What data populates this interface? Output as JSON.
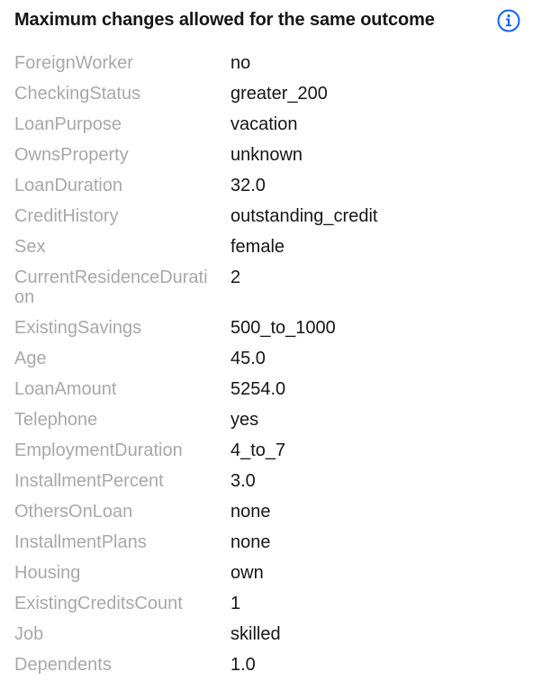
{
  "header": {
    "title": "Maximum changes allowed for the same outcome",
    "info_icon": "info-icon",
    "accent_color": "#0f62fe"
  },
  "features": [
    {
      "label": "ForeignWorker",
      "value": "no"
    },
    {
      "label": "CheckingStatus",
      "value": "greater_200"
    },
    {
      "label": "LoanPurpose",
      "value": "vacation"
    },
    {
      "label": "OwnsProperty",
      "value": "unknown"
    },
    {
      "label": "LoanDuration",
      "value": "32.0"
    },
    {
      "label": "CreditHistory",
      "value": "outstanding_credit"
    },
    {
      "label": "Sex",
      "value": "female"
    },
    {
      "label": "CurrentResidenceDuration",
      "value": "2"
    },
    {
      "label": "ExistingSavings",
      "value": "500_to_1000"
    },
    {
      "label": "Age",
      "value": "45.0"
    },
    {
      "label": "LoanAmount",
      "value": "5254.0"
    },
    {
      "label": "Telephone",
      "value": "yes"
    },
    {
      "label": "EmploymentDuration",
      "value": "4_to_7"
    },
    {
      "label": "InstallmentPercent",
      "value": "3.0"
    },
    {
      "label": "OthersOnLoan",
      "value": "none"
    },
    {
      "label": "InstallmentPlans",
      "value": "none"
    },
    {
      "label": "Housing",
      "value": "own"
    },
    {
      "label": "ExistingCreditsCount",
      "value": "1"
    },
    {
      "label": "Job",
      "value": "skilled"
    },
    {
      "label": "Dependents",
      "value": "1.0"
    }
  ]
}
